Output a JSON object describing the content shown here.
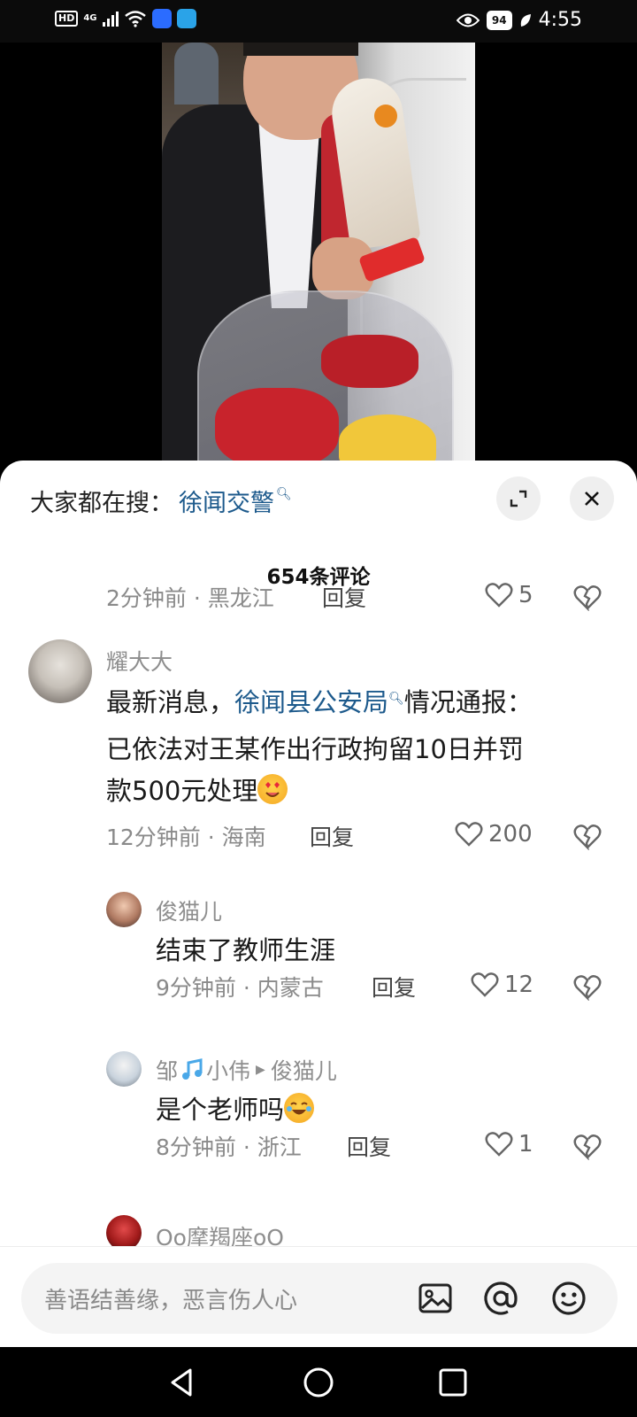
{
  "status_bar": {
    "hd": "HD",
    "network": "4G",
    "battery": "94",
    "time": "4:55"
  },
  "search": {
    "prefix": "大家都在搜：",
    "term": "徐闻交警"
  },
  "comments": {
    "count_label": "654条评论",
    "top_meta": {
      "time_location": "2分钟前 · 黑龙江",
      "reply_label": "回复",
      "likes": "5"
    },
    "main": {
      "username": "耀大大",
      "text_before": "最新消息，",
      "link": "徐闻县公安局",
      "text_line1_after": "情况通报：",
      "text_line2": "已依法对王某作出行政拘留10日并罚",
      "text_line3": "款500元处理",
      "time_location": "12分钟前 · 海南",
      "reply_label": "回复",
      "likes": "200"
    },
    "replies": [
      {
        "username": "俊猫儿",
        "text": "结束了教师生涯",
        "time_location": "9分钟前 · 内蒙古",
        "reply_label": "回复",
        "likes": "12"
      },
      {
        "username_part1": "邹",
        "username_part2": "小伟",
        "reply_to": "俊猫儿",
        "text": "是个老师吗",
        "time_location": "8分钟前 · 浙江",
        "reply_label": "回复",
        "likes": "1"
      },
      {
        "username": "Oo摩羯座oO"
      }
    ]
  },
  "input": {
    "placeholder": "善语结善缘，恶言伤人心"
  },
  "icons": {
    "heart": "heart-outline-icon",
    "dislike": "broken-heart-icon",
    "image": "image-icon",
    "mention": "at-icon",
    "emoji": "smiley-icon"
  },
  "colors": {
    "link": "#1d5a8c",
    "meta": "#8a8a8a",
    "sheet_bg": "#ffffff"
  }
}
